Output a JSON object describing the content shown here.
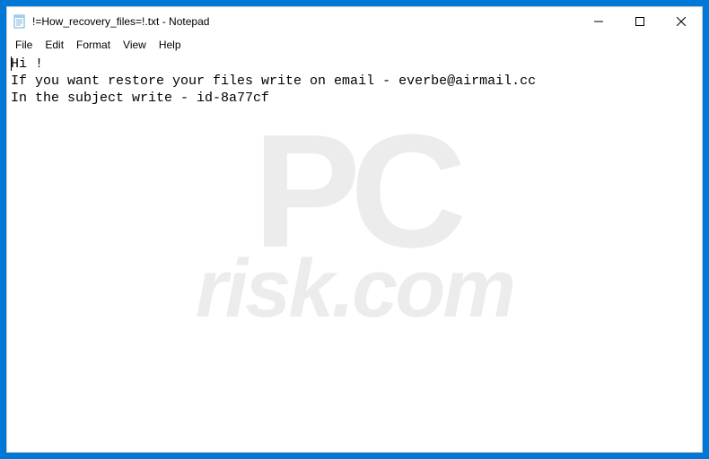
{
  "window": {
    "title": "!=How_recovery_files=!.txt - Notepad"
  },
  "menu": {
    "file": "File",
    "edit": "Edit",
    "format": "Format",
    "view": "View",
    "help": "Help"
  },
  "content": {
    "line1": "Hi !",
    "line2": "If you want restore your files write on email - everbe@airmail.cc",
    "line3": "In the subject write - id-8a77cf"
  },
  "watermark": {
    "top": "PC",
    "bottom": "risk.com"
  }
}
